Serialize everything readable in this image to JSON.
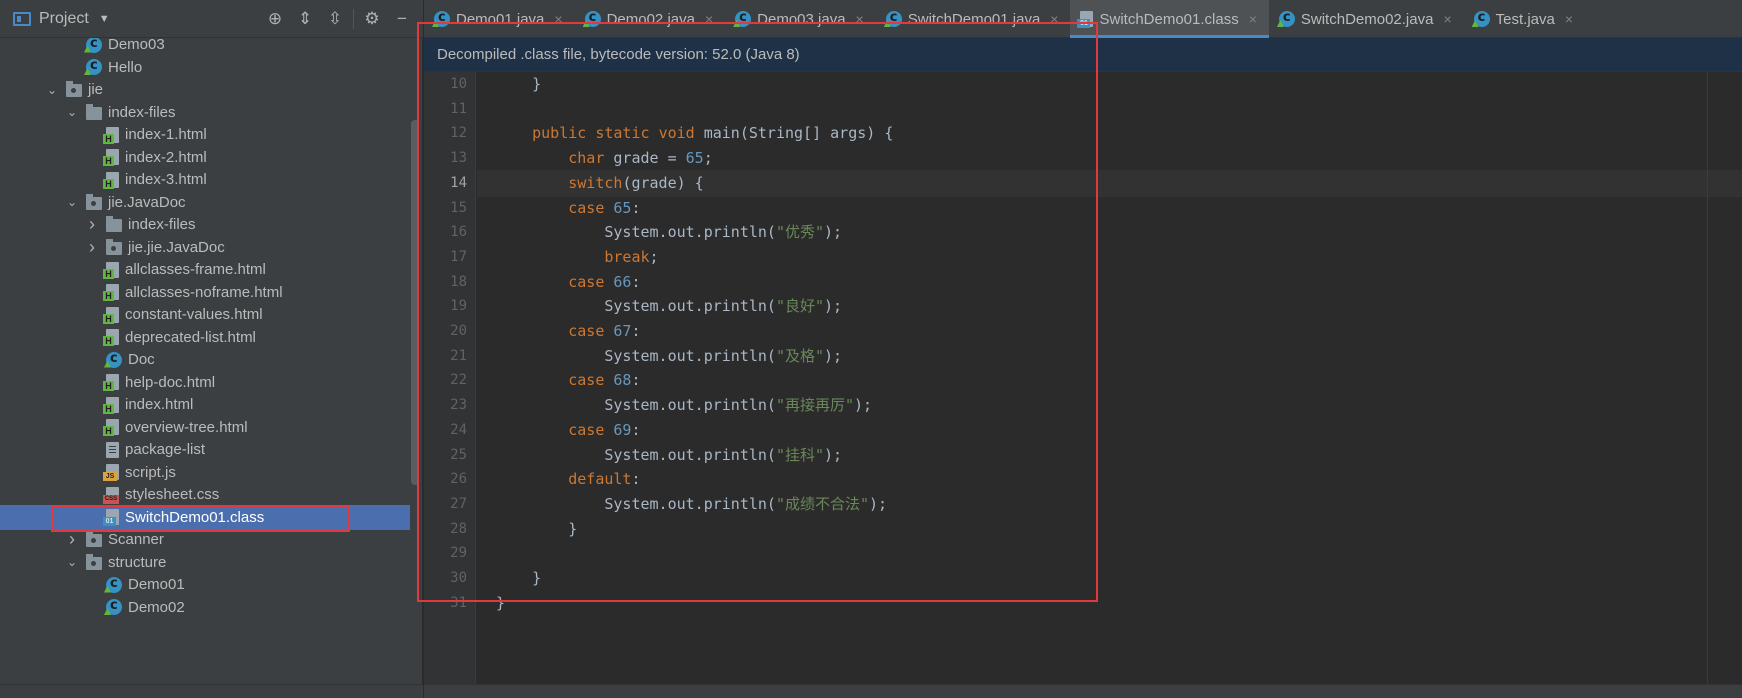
{
  "project_panel": {
    "title": "Project",
    "tree": [
      {
        "label": "Demo03",
        "icon": "class-c",
        "indent": 106,
        "arrow": ""
      },
      {
        "label": "Hello",
        "icon": "class-c",
        "indent": 106,
        "arrow": ""
      },
      {
        "label": "jie",
        "icon": "pkg",
        "indent": 86,
        "arrow": "v"
      },
      {
        "label": "index-files",
        "icon": "folder",
        "indent": 106,
        "arrow": "v"
      },
      {
        "label": "index-1.html",
        "icon": "html",
        "indent": 126,
        "arrow": ""
      },
      {
        "label": "index-2.html",
        "icon": "html",
        "indent": 126,
        "arrow": ""
      },
      {
        "label": "index-3.html",
        "icon": "html",
        "indent": 126,
        "arrow": ""
      },
      {
        "label": "jie.JavaDoc",
        "icon": "pkg",
        "indent": 106,
        "arrow": "v"
      },
      {
        "label": "index-files",
        "icon": "folder",
        "indent": 126,
        "arrow": ">"
      },
      {
        "label": "jie.jie.JavaDoc",
        "icon": "pkg",
        "indent": 126,
        "arrow": ">"
      },
      {
        "label": "allclasses-frame.html",
        "icon": "html",
        "indent": 126,
        "arrow": ""
      },
      {
        "label": "allclasses-noframe.html",
        "icon": "html",
        "indent": 126,
        "arrow": ""
      },
      {
        "label": "constant-values.html",
        "icon": "html",
        "indent": 126,
        "arrow": ""
      },
      {
        "label": "deprecated-list.html",
        "icon": "html",
        "indent": 126,
        "arrow": ""
      },
      {
        "label": "Doc",
        "icon": "class-c",
        "indent": 126,
        "arrow": ""
      },
      {
        "label": "help-doc.html",
        "icon": "html",
        "indent": 126,
        "arrow": ""
      },
      {
        "label": "index.html",
        "icon": "html",
        "indent": 126,
        "arrow": ""
      },
      {
        "label": "overview-tree.html",
        "icon": "html",
        "indent": 126,
        "arrow": ""
      },
      {
        "label": "package-list",
        "icon": "text",
        "indent": 126,
        "arrow": ""
      },
      {
        "label": "script.js",
        "icon": "js",
        "indent": 126,
        "arrow": ""
      },
      {
        "label": "stylesheet.css",
        "icon": "css",
        "indent": 126,
        "arrow": ""
      },
      {
        "label": "SwitchDemo01.class",
        "icon": "classfile",
        "indent": 126,
        "arrow": "",
        "selected": true
      },
      {
        "label": "Scanner",
        "icon": "pkg",
        "indent": 106,
        "arrow": ">"
      },
      {
        "label": "structure",
        "icon": "pkg",
        "indent": 106,
        "arrow": "v"
      },
      {
        "label": "Demo01",
        "icon": "class-c",
        "indent": 126,
        "arrow": ""
      },
      {
        "label": "Demo02",
        "icon": "class-c",
        "indent": 126,
        "arrow": ""
      }
    ]
  },
  "tabs": [
    {
      "label": "Demo01.java",
      "icon": "class-c",
      "active": false
    },
    {
      "label": "Demo02.java",
      "icon": "class-c",
      "active": false
    },
    {
      "label": "Demo03.java",
      "icon": "class-c",
      "active": false
    },
    {
      "label": "SwitchDemo01.java",
      "icon": "class-c",
      "active": false
    },
    {
      "label": "SwitchDemo01.class",
      "icon": "classfile",
      "active": true
    },
    {
      "label": "SwitchDemo02.java",
      "icon": "class-c",
      "active": false
    },
    {
      "label": "Test.java",
      "icon": "class-c",
      "active": false
    }
  ],
  "banner": {
    "text": "Decompiled .class file, bytecode version: 52.0 (Java 8)"
  },
  "code": {
    "current_line": 14,
    "lines": [
      {
        "n": 10,
        "text": "    }"
      },
      {
        "n": 11,
        "text": ""
      },
      {
        "n": 12,
        "text": "    public static void main(String[] args) {"
      },
      {
        "n": 13,
        "text": "        char grade = 65;"
      },
      {
        "n": 14,
        "text": "        switch(grade) {"
      },
      {
        "n": 15,
        "text": "        case 65:"
      },
      {
        "n": 16,
        "text": "            System.out.println(\"优秀\");"
      },
      {
        "n": 17,
        "text": "            break;"
      },
      {
        "n": 18,
        "text": "        case 66:"
      },
      {
        "n": 19,
        "text": "            System.out.println(\"良好\");"
      },
      {
        "n": 20,
        "text": "        case 67:"
      },
      {
        "n": 21,
        "text": "            System.out.println(\"及格\");"
      },
      {
        "n": 22,
        "text": "        case 68:"
      },
      {
        "n": 23,
        "text": "            System.out.println(\"再接再厉\");"
      },
      {
        "n": 24,
        "text": "        case 69:"
      },
      {
        "n": 25,
        "text": "            System.out.println(\"挂科\");"
      },
      {
        "n": 26,
        "text": "        default:"
      },
      {
        "n": 27,
        "text": "            System.out.println(\"成绩不合法\");"
      },
      {
        "n": 28,
        "text": "        }"
      },
      {
        "n": 29,
        "text": ""
      },
      {
        "n": 30,
        "text": "    }"
      },
      {
        "n": 31,
        "text": "}"
      }
    ]
  },
  "colors": {
    "keyword": "#cc7832",
    "number": "#6897bb",
    "string": "#6a8759",
    "plain": "#a9b7c6",
    "highlight_box": "#e0393e",
    "selection": "#4b6eaf"
  }
}
